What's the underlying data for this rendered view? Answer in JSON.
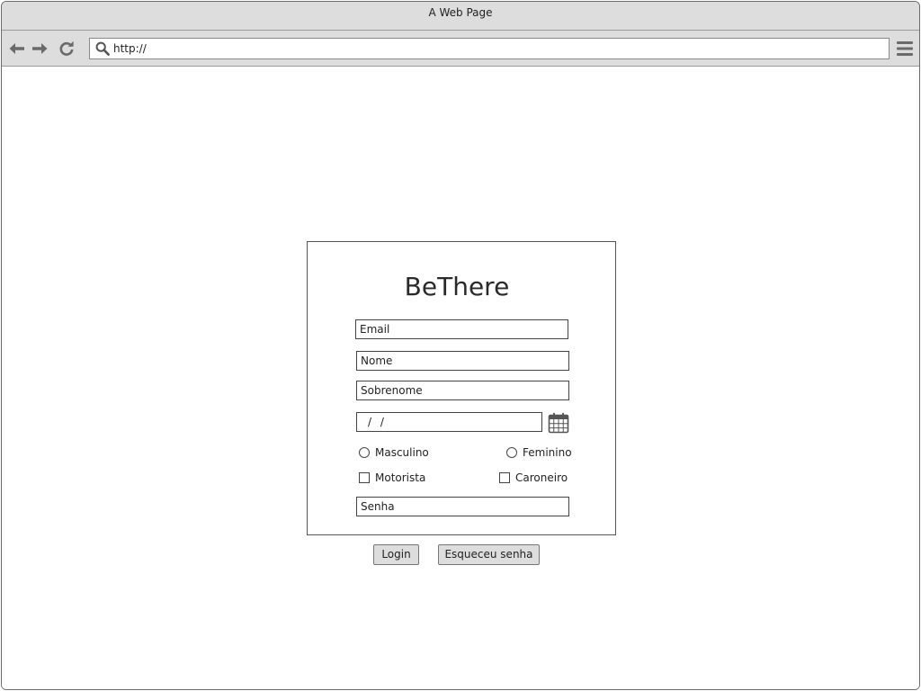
{
  "window": {
    "title": "A Web Page"
  },
  "toolbar": {
    "back_icon": "back-arrow-icon",
    "forward_icon": "forward-arrow-icon",
    "reload_icon": "reload-icon",
    "search_icon": "search-icon",
    "url": "http://",
    "menu_icon": "hamburger-menu-icon"
  },
  "form": {
    "title": "BeThere",
    "email_value": "Email",
    "nome_value": "Nome",
    "sobrenome_value": "Sobrenome",
    "date_value": "/ /",
    "calendar_icon": "calendar-icon",
    "gender": {
      "male_label": "Masculino",
      "female_label": "Feminino"
    },
    "role": {
      "driver_label": "Motorista",
      "rider_label": "Caroneiro"
    },
    "senha_value": "Senha"
  },
  "actions": {
    "login_label": "Login",
    "forgot_label": "Esqueceu senha"
  },
  "colors": {
    "chrome_bg": "#dddddd",
    "border": "#444444",
    "text": "#222222"
  }
}
